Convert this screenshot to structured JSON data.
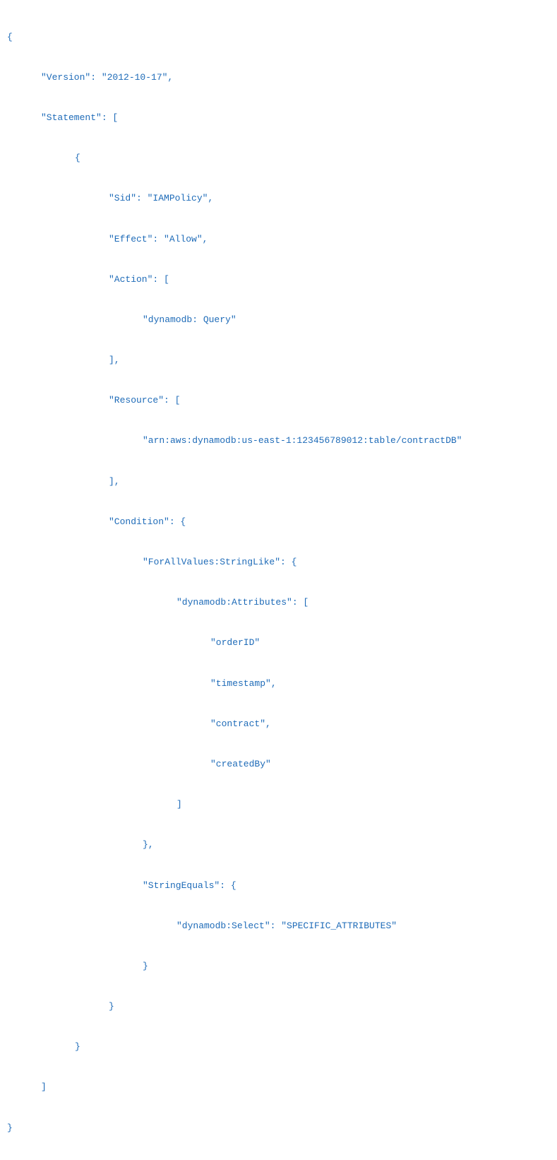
{
  "code": {
    "l1": "{",
    "l2": "\"Version\": \"2012-10-17\",",
    "l3": "\"Statement\": [",
    "l4": "{",
    "l5": "\"Sid\": \"IAMPolicy\",",
    "l6": "\"Effect\": \"Allow\",",
    "l7": "\"Action\": [",
    "l8": "\"dynamodb: Query\"",
    "l9": "],",
    "l10": "\"Resource\": [",
    "l11": "\"arn:aws:dynamodb:us-east-1:123456789012:table/contractDB\"",
    "l12": "],",
    "l13": "\"Condition\": {",
    "l14": "\"ForAllValues:StringLike\": {",
    "l15": "\"dynamodb:Attributes\": [",
    "l16": "\"orderID\"",
    "l17": "\"timestamp\",",
    "l18": "\"contract\",",
    "l19": "\"createdBy\"",
    "l20": "]",
    "l21": "},",
    "l22": "\"StringEquals\": {",
    "l23": "\"dynamodb:Select\": \"SPECIFIC_ATTRIBUTES\"",
    "l24": "}",
    "l25": "}",
    "l26": "}",
    "l27": "]",
    "l28": "}"
  }
}
